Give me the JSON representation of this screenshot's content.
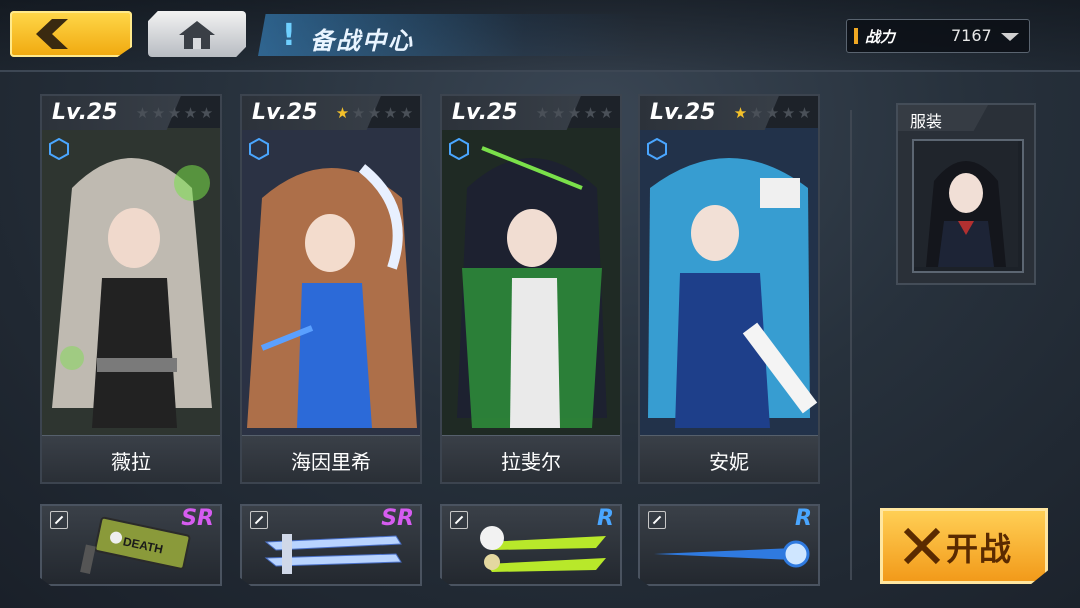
{
  "header": {
    "title_mark": "!",
    "title": "备战中心",
    "power_label": "战力",
    "power_value": "7167"
  },
  "icons": {
    "back": "chevron-left-icon",
    "home": "home-icon",
    "dropdown": "caret-down-icon"
  },
  "characters": [
    {
      "name": "薇拉",
      "level_text": "Lv.25",
      "stars": 0,
      "hair": "#d8d1c8",
      "accent": "#7ae04a"
    },
    {
      "name": "海因里希",
      "level_text": "Lv.25",
      "stars": 1,
      "hair": "#c47a4a",
      "accent": "#5aa0ff"
    },
    {
      "name": "拉斐尔",
      "level_text": "Lv.25",
      "stars": 0,
      "hair": "#1d2130",
      "accent": "#2d8a3a"
    },
    {
      "name": "安妮",
      "level_text": "Lv.25",
      "stars": 1,
      "hair": "#3aa8e0",
      "accent": "#1e3f8a"
    }
  ],
  "weapons": [
    {
      "rarity": "SR",
      "kind": "hammer",
      "label": "DEATH"
    },
    {
      "rarity": "SR",
      "kind": "blades"
    },
    {
      "rarity": "R",
      "kind": "green-blades"
    },
    {
      "rarity": "R",
      "kind": "spear"
    }
  ],
  "costume": {
    "label": "服装"
  },
  "start_button": {
    "label": "开战"
  },
  "colors": {
    "accent_gold": "#f0a823",
    "star_on": "#f4c12a",
    "sr": "#d65cf0",
    "r": "#4aa6ff",
    "title_blue": "#6fd0ff"
  }
}
